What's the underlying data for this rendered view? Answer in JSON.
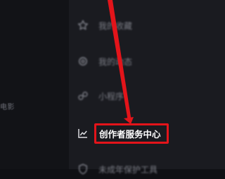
{
  "left_pane": {
    "partial_text": "电影"
  },
  "menu": {
    "items": [
      {
        "label": "我的收藏",
        "icon": "star-icon"
      },
      {
        "label": "我的动态",
        "icon": "settings-gear-icon"
      },
      {
        "label": "小程序",
        "icon": "mini-program-icon"
      },
      {
        "label": "创作者服务中心",
        "icon": "line-chart-icon"
      },
      {
        "label": "未成年保护工具",
        "icon": "shield-icon"
      }
    ]
  },
  "annotation": {
    "highlight_color": "#e3141a",
    "arrow_color": "#e3141a"
  }
}
